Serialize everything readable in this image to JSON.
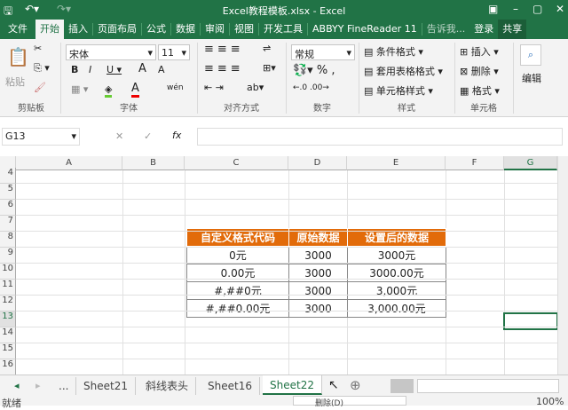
{
  "title": "Excel教程模板.xlsx - Excel",
  "tabs": [
    "文件",
    "开始",
    "插入",
    "页面布局",
    "公式",
    "数据",
    "审阅",
    "视图",
    "开发工具",
    "ABBYY FineReader 11",
    "告诉我...",
    "登录",
    "共享"
  ],
  "ribbon": {
    "paste": "粘贴",
    "font_name": "宋体",
    "font_size": "11",
    "number_format": "常规",
    "conditional": "条件格式 ▾",
    "table_format": "套用表格格式 ▾",
    "cell_style": "单元格样式 ▾",
    "insert": "插入 ▾",
    "delete": "删除 ▾",
    "format": "格式 ▾",
    "edit": "编辑",
    "groups": [
      "剪贴板",
      "字体",
      "对齐方式",
      "数字",
      "样式",
      "单元格"
    ]
  },
  "formula": {
    "name_box": "G13",
    "fx": "fx",
    "value": ""
  },
  "columns": [
    "A",
    "B",
    "C",
    "D",
    "E",
    "F",
    "G"
  ],
  "rows": [
    "4",
    "5",
    "6",
    "7",
    "8",
    "9",
    "10",
    "11",
    "12",
    "13",
    "14",
    "15",
    "16"
  ],
  "table": {
    "headers": [
      "自定义格式代码",
      "原始数据",
      "设置后的数据"
    ],
    "rows": [
      [
        "0元",
        "3000",
        "3000元"
      ],
      [
        "0.00元",
        "3000",
        "3000.00元"
      ],
      [
        "#,##0元",
        "3000",
        "3,000元"
      ],
      [
        "#,##0.00元",
        "3000",
        "3,000.00元"
      ]
    ]
  },
  "sheets": {
    "more": "...",
    "tabs": [
      "Sheet21",
      "斜线表头",
      "Sheet16",
      "Sheet22"
    ],
    "active": "Sheet22"
  },
  "status": {
    "ready": "就绪",
    "menu": "删除(D)",
    "zoom": "100%"
  },
  "colors": {
    "brand": "#217346",
    "header": "#e26b0a"
  }
}
